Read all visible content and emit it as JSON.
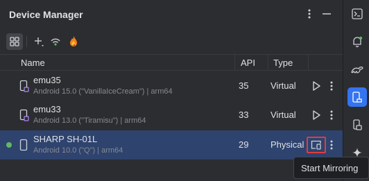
{
  "panel": {
    "title": "Device Manager"
  },
  "toolbar": {
    "icons": [
      "device-grid-icon",
      "add-icon",
      "wifi-pair-icon",
      "firebase-icon"
    ]
  },
  "table": {
    "columns": {
      "name": "Name",
      "api": "API",
      "type": "Type"
    },
    "rows": [
      {
        "name": "emu35",
        "details": "Android 15.0 (\"VanillaIceCream\") | arm64",
        "api": "35",
        "type": "Virtual",
        "selected": false,
        "online": false
      },
      {
        "name": "emu33",
        "details": "Android 13.0 (\"Tiramisu\") | arm64",
        "api": "33",
        "type": "Virtual",
        "selected": false,
        "online": false
      },
      {
        "name": "SHARP SH-01L",
        "details": "Android 10.0 (\"Q\") | arm64",
        "api": "29",
        "type": "Physical",
        "selected": true,
        "online": true
      }
    ]
  },
  "tooltip": {
    "text": "Start Mirroring"
  },
  "colors": {
    "selection": "#2e436e",
    "online": "#5fb865",
    "accent": "#3574f0",
    "highlight": "#e33b3b",
    "emulator_badge": "#b189f5"
  },
  "right_strip": {
    "icons": [
      "terminal-icon",
      "notifications-icon",
      "gradle-icon",
      "device-manager-icon",
      "running-devices-icon",
      "gemini-icon"
    ]
  }
}
